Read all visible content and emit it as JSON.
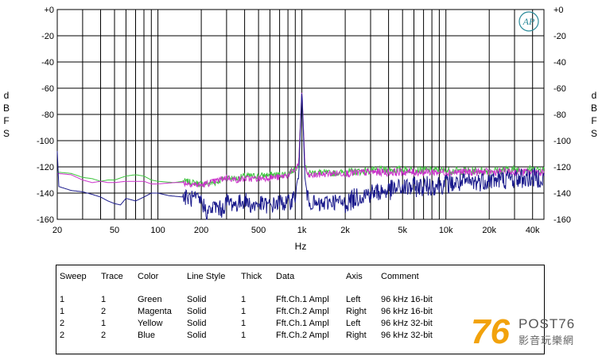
{
  "chart_data": {
    "type": "line",
    "xlabel": "Hz",
    "ylabel_left": [
      "d",
      "B",
      "F",
      "S"
    ],
    "ylabel_right": [
      "d",
      "B",
      "F",
      "S"
    ],
    "x_scale": "log",
    "xlim": [
      20,
      48000
    ],
    "ylim": [
      -160,
      0
    ],
    "grid": true,
    "x_ticks": [
      {
        "v": 20,
        "label": "20"
      },
      {
        "v": 50,
        "label": "50"
      },
      {
        "v": 100,
        "label": "100"
      },
      {
        "v": 200,
        "label": "200"
      },
      {
        "v": 500,
        "label": "500"
      },
      {
        "v": 1000,
        "label": "1k"
      },
      {
        "v": 2000,
        "label": "2k"
      },
      {
        "v": 5000,
        "label": "5k"
      },
      {
        "v": 10000,
        "label": "10k"
      },
      {
        "v": 20000,
        "label": "20k"
      },
      {
        "v": 40000,
        "label": "40k"
      }
    ],
    "y_ticks": [
      {
        "v": 0,
        "label": "+0"
      },
      {
        "v": -20,
        "label": "-20"
      },
      {
        "v": -40,
        "label": "-40"
      },
      {
        "v": -60,
        "label": "-60"
      },
      {
        "v": -80,
        "label": "-80"
      },
      {
        "v": -100,
        "label": "-100"
      },
      {
        "v": -120,
        "label": "-120"
      },
      {
        "v": -140,
        "label": "-140"
      },
      {
        "v": -160,
        "label": "-160"
      }
    ],
    "series": [
      {
        "color": "#3cc43c",
        "points": [
          [
            20,
            -124
          ],
          [
            25,
            -125
          ],
          [
            30,
            -128
          ],
          [
            35,
            -129
          ],
          [
            40,
            -131
          ],
          [
            45,
            -130
          ],
          [
            50,
            -130
          ],
          [
            60,
            -127
          ],
          [
            70,
            -126
          ],
          [
            80,
            -127
          ],
          [
            90,
            -130
          ],
          [
            100,
            -131
          ],
          [
            130,
            -132
          ],
          [
            150,
            -131
          ],
          [
            200,
            -133
          ],
          [
            250,
            -132
          ],
          [
            300,
            -128
          ],
          [
            350,
            -129
          ],
          [
            400,
            -127
          ],
          [
            500,
            -127
          ],
          [
            600,
            -126
          ],
          [
            700,
            -126
          ],
          [
            800,
            -125
          ],
          [
            900,
            -121
          ],
          [
            950,
            -118
          ],
          [
            1000,
            -62
          ],
          [
            1050,
            -119
          ],
          [
            1100,
            -125
          ],
          [
            1300,
            -124
          ],
          [
            1600,
            -125
          ],
          [
            2000,
            -124
          ],
          [
            3000,
            -123
          ],
          [
            5000,
            -122
          ],
          [
            10000,
            -123
          ],
          [
            20000,
            -123
          ],
          [
            30000,
            -122
          ],
          [
            48000,
            -122
          ]
        ]
      },
      {
        "color": "#cc33cc",
        "points": [
          [
            20,
            -125
          ],
          [
            25,
            -126
          ],
          [
            30,
            -130
          ],
          [
            35,
            -132
          ],
          [
            40,
            -131
          ],
          [
            45,
            -132
          ],
          [
            50,
            -132
          ],
          [
            60,
            -131
          ],
          [
            70,
            -131
          ],
          [
            80,
            -131
          ],
          [
            90,
            -133
          ],
          [
            100,
            -133
          ],
          [
            130,
            -132
          ],
          [
            150,
            -132
          ],
          [
            200,
            -134
          ],
          [
            250,
            -131
          ],
          [
            300,
            -128
          ],
          [
            350,
            -130
          ],
          [
            400,
            -129
          ],
          [
            500,
            -129
          ],
          [
            600,
            -128
          ],
          [
            700,
            -128
          ],
          [
            800,
            -126
          ],
          [
            900,
            -122
          ],
          [
            950,
            -118
          ],
          [
            1000,
            -60
          ],
          [
            1050,
            -119
          ],
          [
            1100,
            -127
          ],
          [
            1300,
            -126
          ],
          [
            1600,
            -125
          ],
          [
            2000,
            -125
          ],
          [
            3000,
            -124
          ],
          [
            5000,
            -124
          ],
          [
            10000,
            -124
          ],
          [
            20000,
            -124
          ],
          [
            30000,
            -124
          ],
          [
            48000,
            -124
          ]
        ]
      },
      {
        "color": "#1a1a8c",
        "points": [
          [
            20,
            -108
          ],
          [
            20.5,
            -135
          ],
          [
            25,
            -138
          ],
          [
            30,
            -139
          ],
          [
            35,
            -141
          ],
          [
            40,
            -143
          ],
          [
            45,
            -146
          ],
          [
            50,
            -148
          ],
          [
            55,
            -149
          ],
          [
            60,
            -144
          ],
          [
            70,
            -146
          ],
          [
            80,
            -143
          ],
          [
            90,
            -140
          ],
          [
            100,
            -140
          ],
          [
            120,
            -142
          ],
          [
            150,
            -143
          ],
          [
            200,
            -146
          ],
          [
            220,
            -155
          ],
          [
            250,
            -150
          ],
          [
            280,
            -153
          ],
          [
            300,
            -146
          ],
          [
            350,
            -149
          ],
          [
            400,
            -145
          ],
          [
            450,
            -150
          ],
          [
            500,
            -148
          ],
          [
            600,
            -150
          ],
          [
            700,
            -147
          ],
          [
            800,
            -148
          ],
          [
            900,
            -142
          ],
          [
            950,
            -128
          ],
          [
            1000,
            -60
          ],
          [
            1050,
            -128
          ],
          [
            1100,
            -145
          ],
          [
            1300,
            -150
          ],
          [
            1600,
            -146
          ],
          [
            2000,
            -148
          ],
          [
            2500,
            -142
          ],
          [
            3000,
            -140
          ],
          [
            4000,
            -138
          ],
          [
            5000,
            -136
          ],
          [
            7000,
            -135
          ],
          [
            10000,
            -133
          ],
          [
            15000,
            -132
          ],
          [
            20000,
            -130
          ],
          [
            30000,
            -129
          ],
          [
            48000,
            -128
          ]
        ]
      }
    ]
  },
  "legend": {
    "headers": [
      "Sweep",
      "Trace",
      "Color",
      "Line Style",
      "Thick",
      "Data",
      "Axis",
      "Comment"
    ],
    "rows": [
      [
        "1",
        "1",
        "Green",
        "Solid",
        "1",
        "Fft.Ch.1 Ampl",
        "Left",
        "96 kHz 16-bit"
      ],
      [
        "1",
        "2",
        "Magenta",
        "Solid",
        "1",
        "Fft.Ch.2 Ampl",
        "Right",
        "96 kHz 16-bit"
      ],
      [
        "2",
        "1",
        "Yellow",
        "Solid",
        "1",
        "Fft.Ch.1 Ampl",
        "Left",
        "96 kHz 32-bit"
      ],
      [
        "2",
        "2",
        "Blue",
        "Solid",
        "1",
        "Fft.Ch.2 Ampl",
        "Right",
        "96 kHz 32-bit"
      ]
    ]
  },
  "badge": {
    "logo_text": "AP"
  },
  "watermark": {
    "number": "76",
    "brand": "POST76",
    "subtitle": "影音玩樂網"
  }
}
